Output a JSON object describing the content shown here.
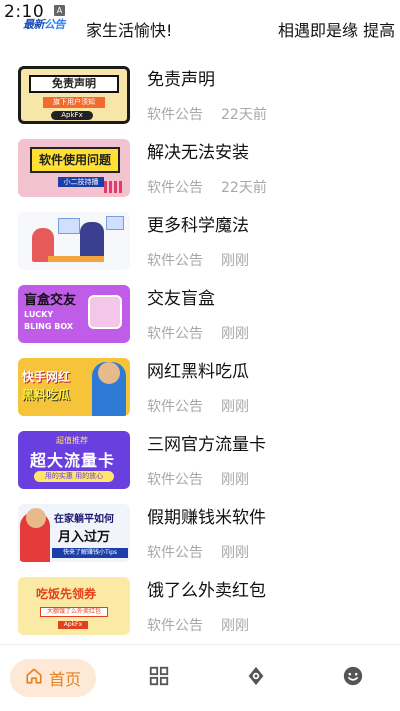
{
  "status_bar": {
    "time": "2:10",
    "notice_logo_a": "最新",
    "notice_logo_b": "公告",
    "notice_badge": "A"
  },
  "ticker": {
    "left_text": "家生活愉快!",
    "right_text": "相遇即是缘  提高"
  },
  "articles": [
    {
      "title": "免责声明",
      "category": "软件公告",
      "time": "22天前",
      "thumb": {
        "line1": "免责声明",
        "line2": "旗下用户须知",
        "line3": "ApkFx"
      }
    },
    {
      "title": "解决无法安装",
      "category": "软件公告",
      "time": "22天前",
      "thumb": {
        "line1": "软件使用问题",
        "line2": "小二技持播"
      }
    },
    {
      "title": "更多科学魔法",
      "category": "软件公告",
      "time": "刚刚",
      "thumb": {}
    },
    {
      "title": "交友盲盒",
      "category": "软件公告",
      "time": "刚刚",
      "thumb": {
        "line1": "盲盒交友",
        "line2": "LUCKY",
        "line3": "BLING BOX"
      }
    },
    {
      "title": "网红黑料吃瓜",
      "category": "软件公告",
      "time": "刚刚",
      "thumb": {
        "line1": "快手网红",
        "line2": "黑料吃瓜"
      }
    },
    {
      "title": "三网官方流量卡",
      "category": "软件公告",
      "time": "刚刚",
      "thumb": {
        "line1": "超值推荐",
        "line2": "超大流量卡",
        "line3": "用的实惠 用的放心"
      }
    },
    {
      "title": "假期赚钱米软件",
      "category": "软件公告",
      "time": "刚刚",
      "thumb": {
        "line1": "在家躺平如何",
        "line2": "月入过万",
        "line3": "快来了解赚钱小Tips"
      }
    },
    {
      "title": "饿了么外卖红包",
      "category": "软件公告",
      "time": "刚刚",
      "thumb": {
        "line1": "吃饭先领券",
        "line2": "大额饿了么外卖红包",
        "line3": "ApkFx"
      }
    }
  ],
  "bottom_nav": {
    "home_label": "首页",
    "active": "home",
    "active_color": "#e0832a",
    "active_bg": "#fde9d6",
    "icons": [
      "home-icon",
      "grid-icon",
      "explore-icon",
      "face-icon"
    ]
  }
}
